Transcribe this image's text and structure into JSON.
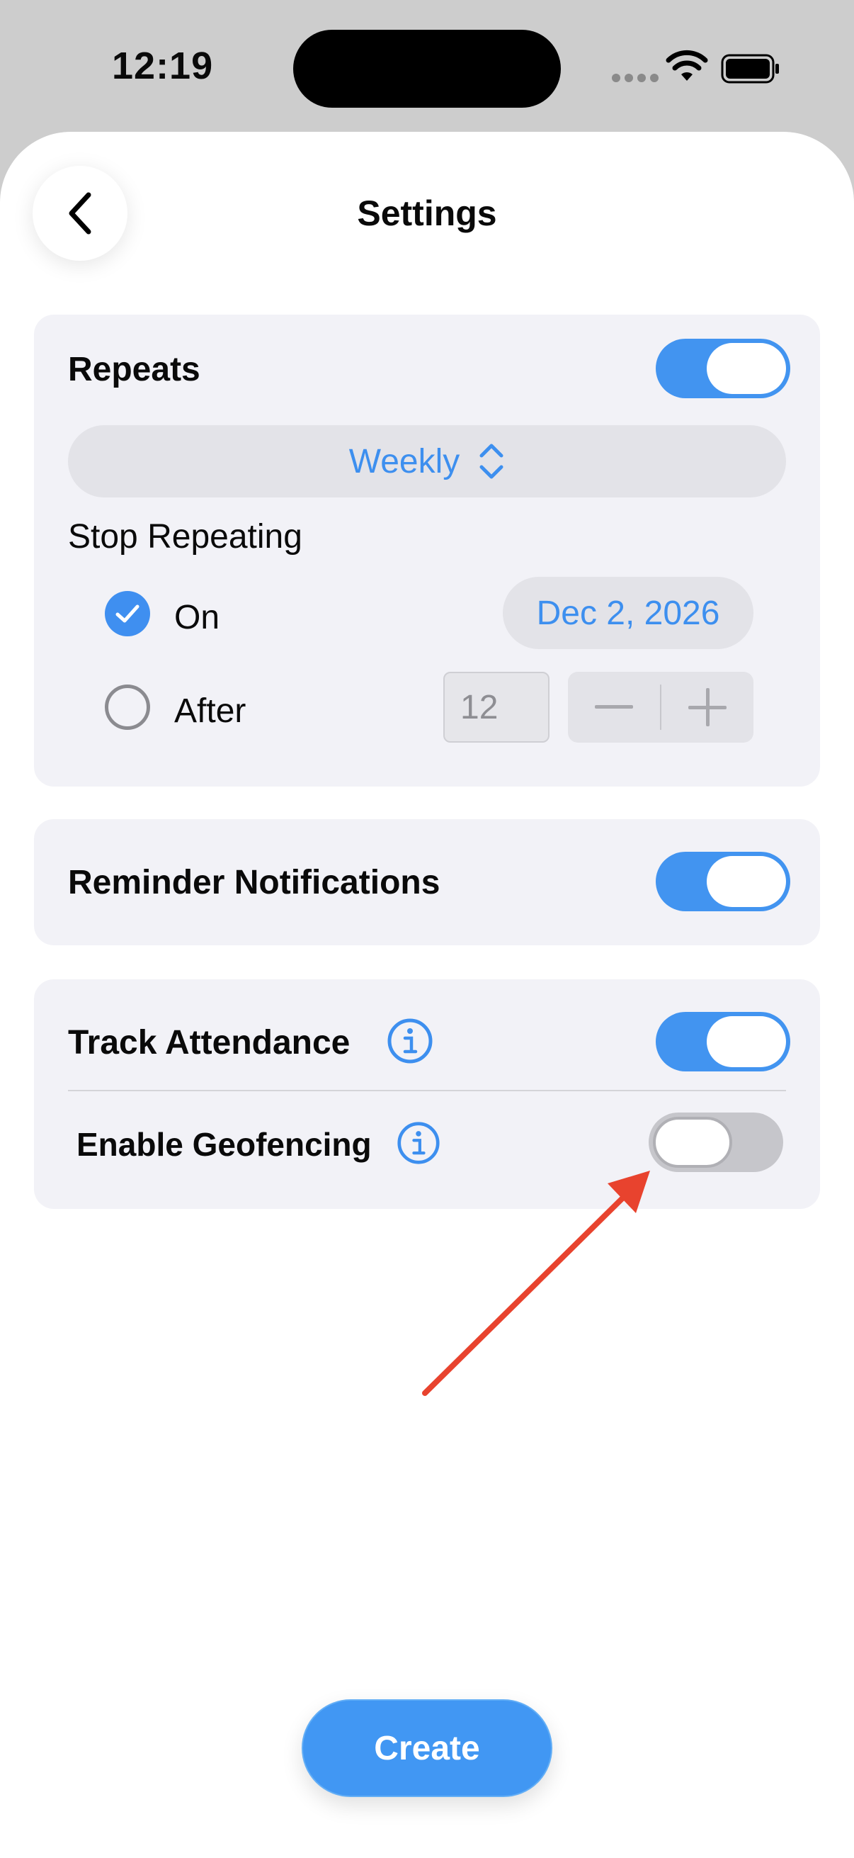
{
  "status_bar": {
    "time": "12:19"
  },
  "header": {
    "title": "Settings",
    "back_icon": "chevron-left-icon"
  },
  "repeat_card": {
    "repeats_label": "Repeats",
    "repeats_on": true,
    "frequency": "Weekly",
    "stop_label": "Stop Repeating",
    "on_option": {
      "label": "On",
      "selected": true,
      "date": "Dec 2, 2026"
    },
    "after_option": {
      "label": "After",
      "selected": false,
      "count": "12"
    }
  },
  "notifications_card": {
    "label": "Reminder Notifications",
    "enabled": true
  },
  "attendance_card": {
    "track_label": "Track Attendance",
    "track_enabled": true,
    "geofencing_label": "Enable Geofencing",
    "geofencing_enabled": false
  },
  "footer": {
    "create_label": "Create"
  },
  "colors": {
    "accent": "#4294f0",
    "annotation_arrow": "#e8432e"
  }
}
